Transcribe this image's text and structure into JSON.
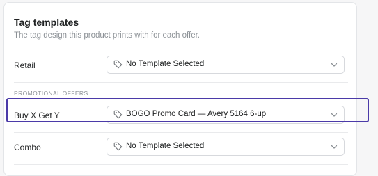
{
  "card": {
    "title": "Tag templates",
    "subtitle": "The tag design this product prints with for each offer."
  },
  "rows": [
    {
      "label": "Retail",
      "value": "No Template Selected",
      "icon": "tag-icon"
    },
    {
      "label": "Buy X Get Y",
      "value": "BOGO Promo Card — Avery 5164 6-up",
      "icon": "tag-icon",
      "highlighted": true
    },
    {
      "label": "Combo",
      "value": "No Template Selected",
      "icon": "tag-icon"
    }
  ],
  "sections": {
    "promotional": "PROMOTIONAL OFFERS"
  },
  "colors": {
    "highlight_outline": "#4b3aa8",
    "card_background": "#ffffff",
    "page_background": "#f6f6f7",
    "muted_text": "#8c9196"
  }
}
